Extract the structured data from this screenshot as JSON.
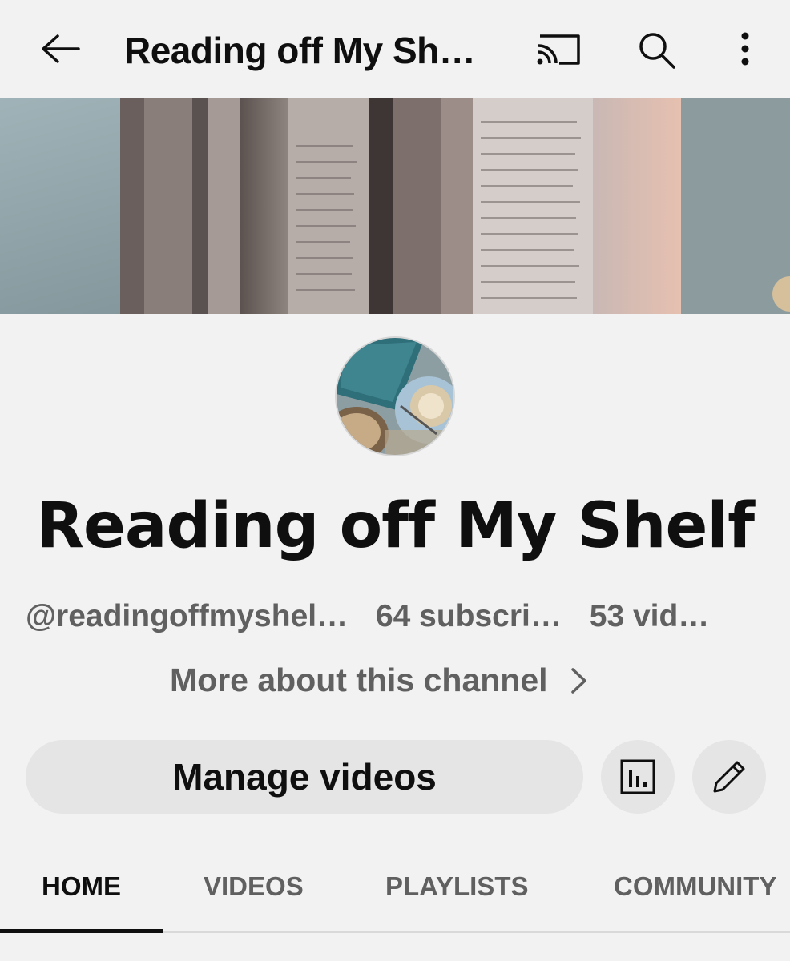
{
  "appbar": {
    "title": "Reading off My Sh…",
    "icons": [
      "back-arrow-icon",
      "cast-icon",
      "search-icon",
      "more-vert-icon"
    ]
  },
  "banner": {
    "description_icon": "banner-image"
  },
  "channel": {
    "name": "Reading off My Shelf",
    "handle": "@readingoffmyshel…",
    "subscribers": "64 subscri…",
    "videos": "53 vid…",
    "more_about": "More about this channel"
  },
  "actions": {
    "manage_videos": "Manage videos",
    "icons": [
      "analytics-icon",
      "edit-pencil-icon"
    ]
  },
  "tabs": [
    {
      "label": "HOME",
      "active": true
    },
    {
      "label": "VIDEOS",
      "active": false
    },
    {
      "label": "PLAYLISTS",
      "active": false
    },
    {
      "label": "COMMUNITY",
      "active": false
    }
  ],
  "colors": {
    "background": "#f2f2f2",
    "text_primary": "#0f0f0f",
    "text_secondary": "#606060",
    "button_bg": "#e5e5e5"
  }
}
